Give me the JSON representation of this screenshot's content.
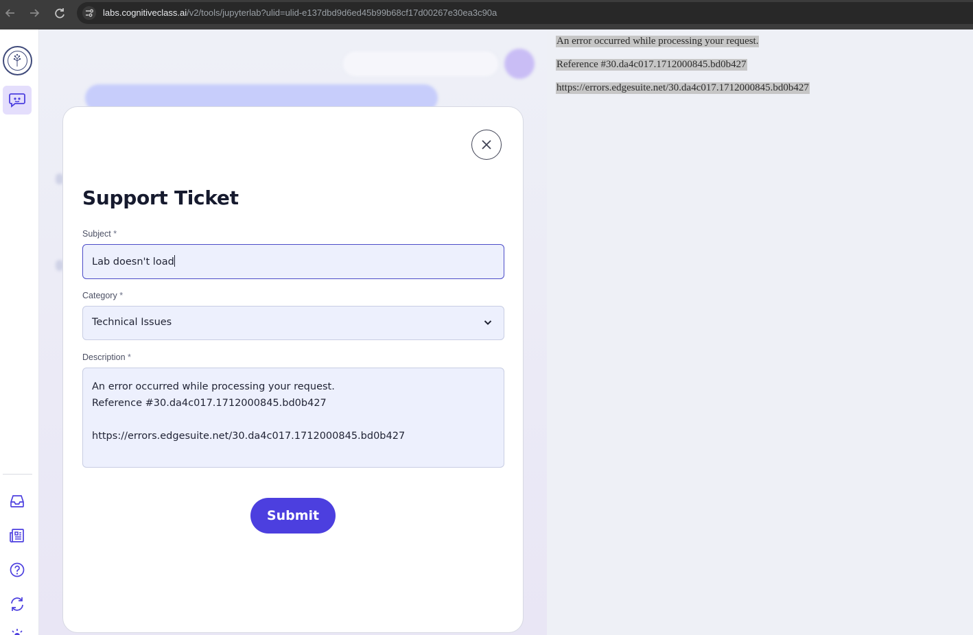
{
  "browser": {
    "url_host": "labs.cognitiveclass.ai",
    "url_path": "/v2/tools/jupyterlab?ulid=ulid-e137dbd9d6ed45b99b68cf17d00267e30ea3c90a",
    "icons": [
      "back-arrow-icon",
      "forward-arrow-icon",
      "reload-icon",
      "site-info-icon"
    ]
  },
  "rail": {
    "icons": [
      "logo-tree-icon",
      "chat-bot-icon",
      "inbox-icon",
      "news-icon",
      "help-icon",
      "refresh-icon",
      "theme-sun-icon"
    ],
    "accent": "#4c3fdf",
    "active_bg": "#e4defc"
  },
  "modal": {
    "title": "Support Ticket",
    "required_mark": "*",
    "subject": {
      "label": "Subject",
      "value": "Lab doesn't load"
    },
    "category": {
      "label": "Category",
      "value": "Technical Issues"
    },
    "description": {
      "label": "Description",
      "value": "An error occurred while processing your request.\nReference #30.da4c017.1712000845.bd0b427\n\nhttps://errors.edgesuite.net/30.da4c017.1712000845.bd0b427"
    },
    "submit_label": "Submit",
    "submit_color": "#4c3fdf"
  },
  "error_page": {
    "lines": [
      "An error occurred while processing your request.",
      "Reference #30.da4c017.1712000845.bd0b427",
      "https://errors.edgesuite.net/30.da4c017.1712000845.bd0b427"
    ]
  }
}
